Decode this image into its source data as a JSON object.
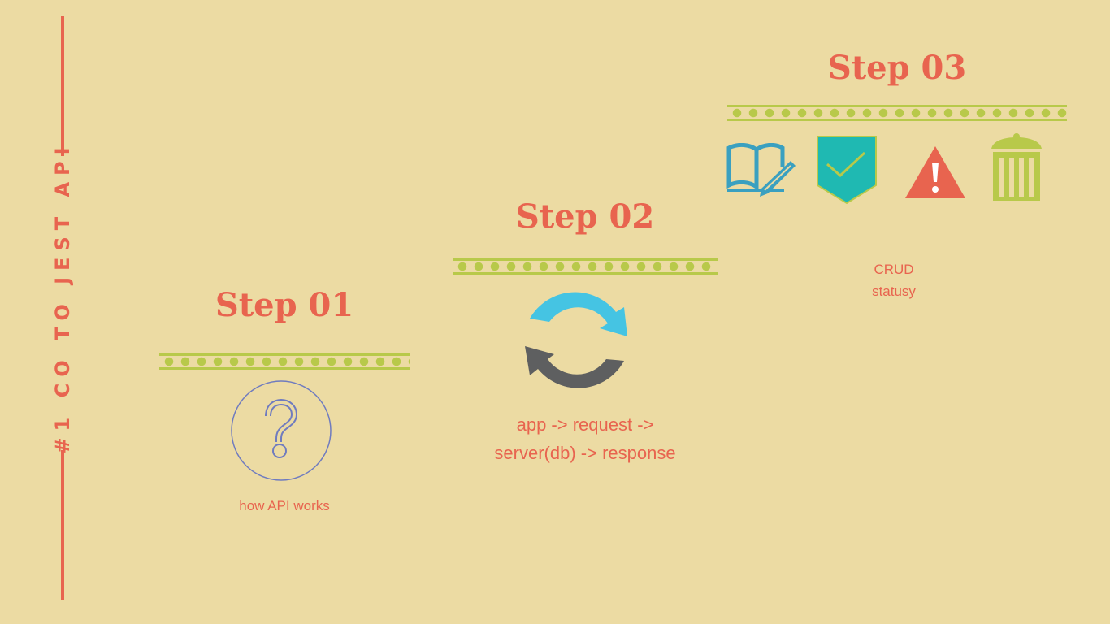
{
  "side_title": "#1 CO TO JEST API",
  "steps": [
    {
      "title": "Step 01",
      "caption": "how API works",
      "icon": "question-icon"
    },
    {
      "title": "Step 02",
      "caption_lines": [
        "app -> request ->",
        "server(db) -> response"
      ],
      "icon": "refresh-cycle-icon"
    },
    {
      "title": "Step 03",
      "caption_lines": [
        "CRUD",
        "statusy"
      ],
      "icons": [
        "book-pencil-icon",
        "checkmark-shield-icon",
        "warning-icon",
        "trash-can-icon"
      ]
    }
  ],
  "colors": {
    "background": "#ecdba3",
    "accent": "#e8644f",
    "dots": "#b8c94a",
    "blue": "#45c4e3",
    "gray": "#5e5f60",
    "teal": "#1fb9b2",
    "question": "#6f7bbf"
  }
}
